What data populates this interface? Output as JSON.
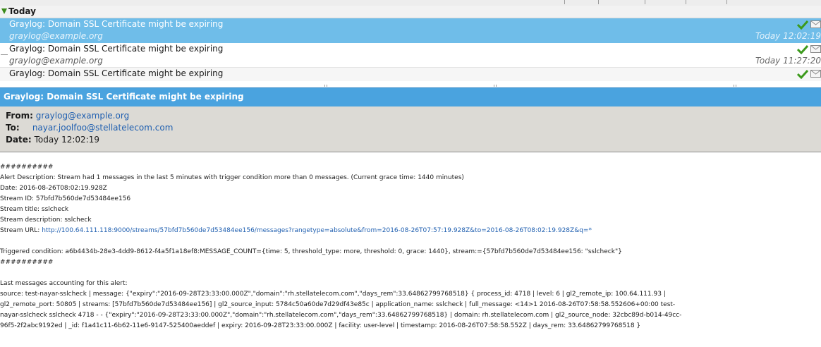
{
  "message_list": {
    "group_label": "Today",
    "rows": [
      {
        "subject": "Graylog: Domain SSL Certificate might be expiring",
        "from": "graylog@example.org",
        "date": "Today 12:02:19",
        "selected": true
      },
      {
        "subject": "Graylog: Domain SSL Certificate might be expiring",
        "from": "graylog@example.org",
        "date": "Today 11:27:20",
        "selected": false
      },
      {
        "subject": "Graylog: Domain SSL Certificate might be expiring",
        "from": "",
        "date": "",
        "selected": false
      }
    ]
  },
  "reader": {
    "subject": "Graylog: Domain SSL Certificate might be expiring",
    "from_label": "From:",
    "from_value": "graylog@example.org",
    "to_label": "To:",
    "to_value": "nayar.joolfoo@stellatelecom.com",
    "date_label": "Date:",
    "date_value": "Today 12:02:19"
  },
  "body": {
    "hash1": "##########",
    "alert_description": "Alert Description: Stream had 1 messages in the last 5 minutes with trigger condition more than 0 messages. (Current grace time: 1440 minutes)",
    "date": "Date: 2016-08-26T08:02:19.928Z",
    "stream_id": "Stream ID: 57bfd7b560de7d53484ee156",
    "stream_title": "Stream title: sslcheck",
    "stream_description": "Stream description: sslcheck",
    "stream_url_label": "Stream URL: ",
    "stream_url": "http://100.64.111.118:9000/streams/57bfd7b560de7d53484ee156/messages?rangetype=absolute&from=2016-08-26T07:57:19.928Z&to=2016-08-26T08:02:19.928Z&q=*",
    "triggered": "Triggered condition: a6b4434b-28e3-4dd9-8612-f4a5f1a18ef8:MESSAGE_COUNT={time: 5, threshold_type: more, threshold: 0, grace: 1440}, stream:={57bfd7b560de7d53484ee156: \"sslcheck\"}",
    "hash2": "##########",
    "last_messages_label": "Last messages accounting for this alert:",
    "last_msg_line1": "source: test-nayar-sslcheck | message: {\"expiry\":\"2016-09-28T23:33:00.000Z\",\"domain\":\"rh.stellatelecom.com\",\"days_rem\":33.64862799768518} { process_id: 4718 | level: 6 | gl2_remote_ip: 100.64.111.93 |",
    "last_msg_line2": "gl2_remote_port: 50805 | streams: [57bfd7b560de7d53484ee156] | gl2_source_input: 5784c50a60de7d29df43e85c | application_name: sslcheck | full_message: <14>1 2016-08-26T07:58:58.552606+00:00 test-",
    "last_msg_line3": "nayar-sslcheck sslcheck 4718 - -  {\"expiry\":\"2016-09-28T23:33:00.000Z\",\"domain\":\"rh.stellatelecom.com\",\"days_rem\":33.64862799768518} | domain: rh.stellatelecom.com | gl2_source_node: 32cbc89d-b014-49cc-",
    "last_msg_line4": "96f5-2f2abc9192ed | _id: f1a41c11-6b62-11e6-9147-525400aeddef | expiry: 2016-09-28T23:33:00.000Z | facility: user-level | timestamp: 2016-08-26T07:58:58.552Z | days_rem: 33.64862799768518 }"
  },
  "icons": {
    "read_status": "check-icon",
    "envelope": "envelope-icon",
    "expand": "triangle-down-icon"
  },
  "colors": {
    "selection": "#6fbde9",
    "subject_bar": "#4aa3df",
    "header_bg": "#dcdad5",
    "link": "#1f5fb0",
    "check_green": "#3c9a1c"
  }
}
